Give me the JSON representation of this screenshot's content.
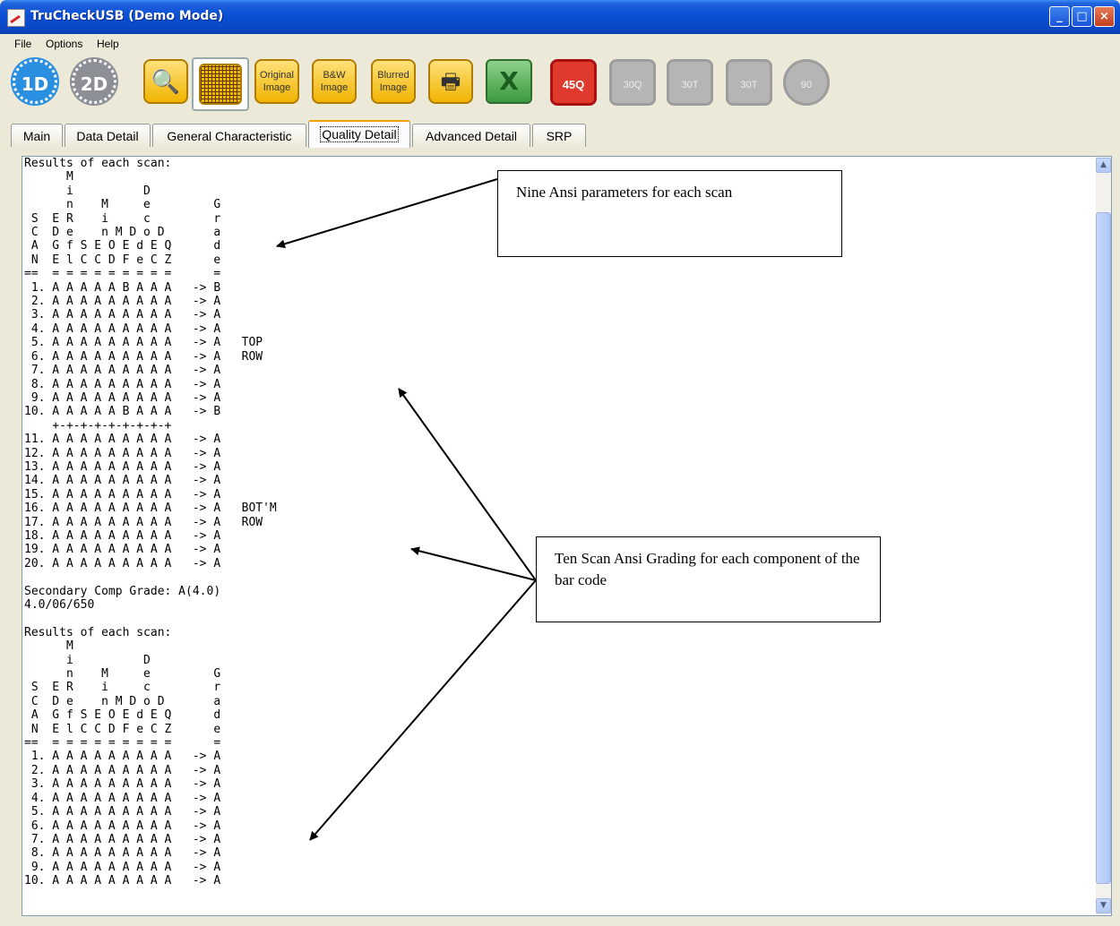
{
  "window": {
    "title": "TruCheckUSB (Demo Mode)",
    "minimize_glyph": "_",
    "maximize_glyph": "□",
    "close_glyph": "×"
  },
  "menu": {
    "file": "File",
    "options": "Options",
    "help": "Help"
  },
  "toolbar": {
    "btn_1d": "1D",
    "btn_2d": "2D",
    "original_image": "Original Image",
    "bw_image": "B&W Image",
    "blurred_image": "Blurred Image",
    "excel_glyph": "X",
    "rot_45q": "45Q",
    "rot_30q": "30Q",
    "rot_30t_a": "30T",
    "rot_30t_b": "30T",
    "rot_90": "90"
  },
  "tabs": [
    "Main",
    "Data Detail",
    "General Characteristic",
    "Quality Detail",
    "Advanced Detail",
    "SRP"
  ],
  "active_tab": "Quality Detail",
  "report_text": "Results of each scan:\n      M\n      i          D\n      n    M     e         G\n S  E R    i     c         r\n C  D e    n M D o D       a\n A  G f S E O E d E Q      d\n N  E l C C D F e C Z      e\n==  = = = = = = = = =      =\n 1. A A A A A B A A A   -> B\n 2. A A A A A A A A A   -> A\n 3. A A A A A A A A A   -> A\n 4. A A A A A A A A A   -> A\n 5. A A A A A A A A A   -> A   TOP\n 6. A A A A A A A A A   -> A   ROW\n 7. A A A A A A A A A   -> A\n 8. A A A A A A A A A   -> A\n 9. A A A A A A A A A   -> A\n10. A A A A A B A A A   -> B\n    +-+-+-+-+-+-+-+-+\n11. A A A A A A A A A   -> A\n12. A A A A A A A A A   -> A\n13. A A A A A A A A A   -> A\n14. A A A A A A A A A   -> A\n15. A A A A A A A A A   -> A\n16. A A A A A A A A A   -> A   BOT'M\n17. A A A A A A A A A   -> A   ROW\n18. A A A A A A A A A   -> A\n19. A A A A A A A A A   -> A\n20. A A A A A A A A A   -> A\n\nSecondary Comp Grade: A(4.0)\n4.0/06/650\n\nResults of each scan:\n      M\n      i          D\n      n    M     e         G\n S  E R    i     c         r\n C  D e    n M D o D       a\n A  G f S E O E d E Q      d\n N  E l C C D F e C Z      e\n==  = = = = = = = = =      =\n 1. A A A A A A A A A   -> A\n 2. A A A A A A A A A   -> A\n 3. A A A A A A A A A   -> A\n 4. A A A A A A A A A   -> A\n 5. A A A A A A A A A   -> A\n 6. A A A A A A A A A   -> A\n 7. A A A A A A A A A   -> A\n 8. A A A A A A A A A   -> A\n 9. A A A A A A A A A   -> A\n10. A A A A A A A A A   -> A",
  "annotations": {
    "nine_params": "Nine Ansi parameters for each scan",
    "ten_scan": "Ten Scan Ansi Grading for each component of the bar code"
  },
  "scrollbar": {
    "up_glyph": "▲",
    "down_glyph": "▼"
  },
  "colors": {
    "titlebar": "#0b4fd5",
    "active_tab_accent": "#f0a000",
    "btn_1d": "#2a8fe0",
    "btn_45q": "#e03a2e"
  }
}
